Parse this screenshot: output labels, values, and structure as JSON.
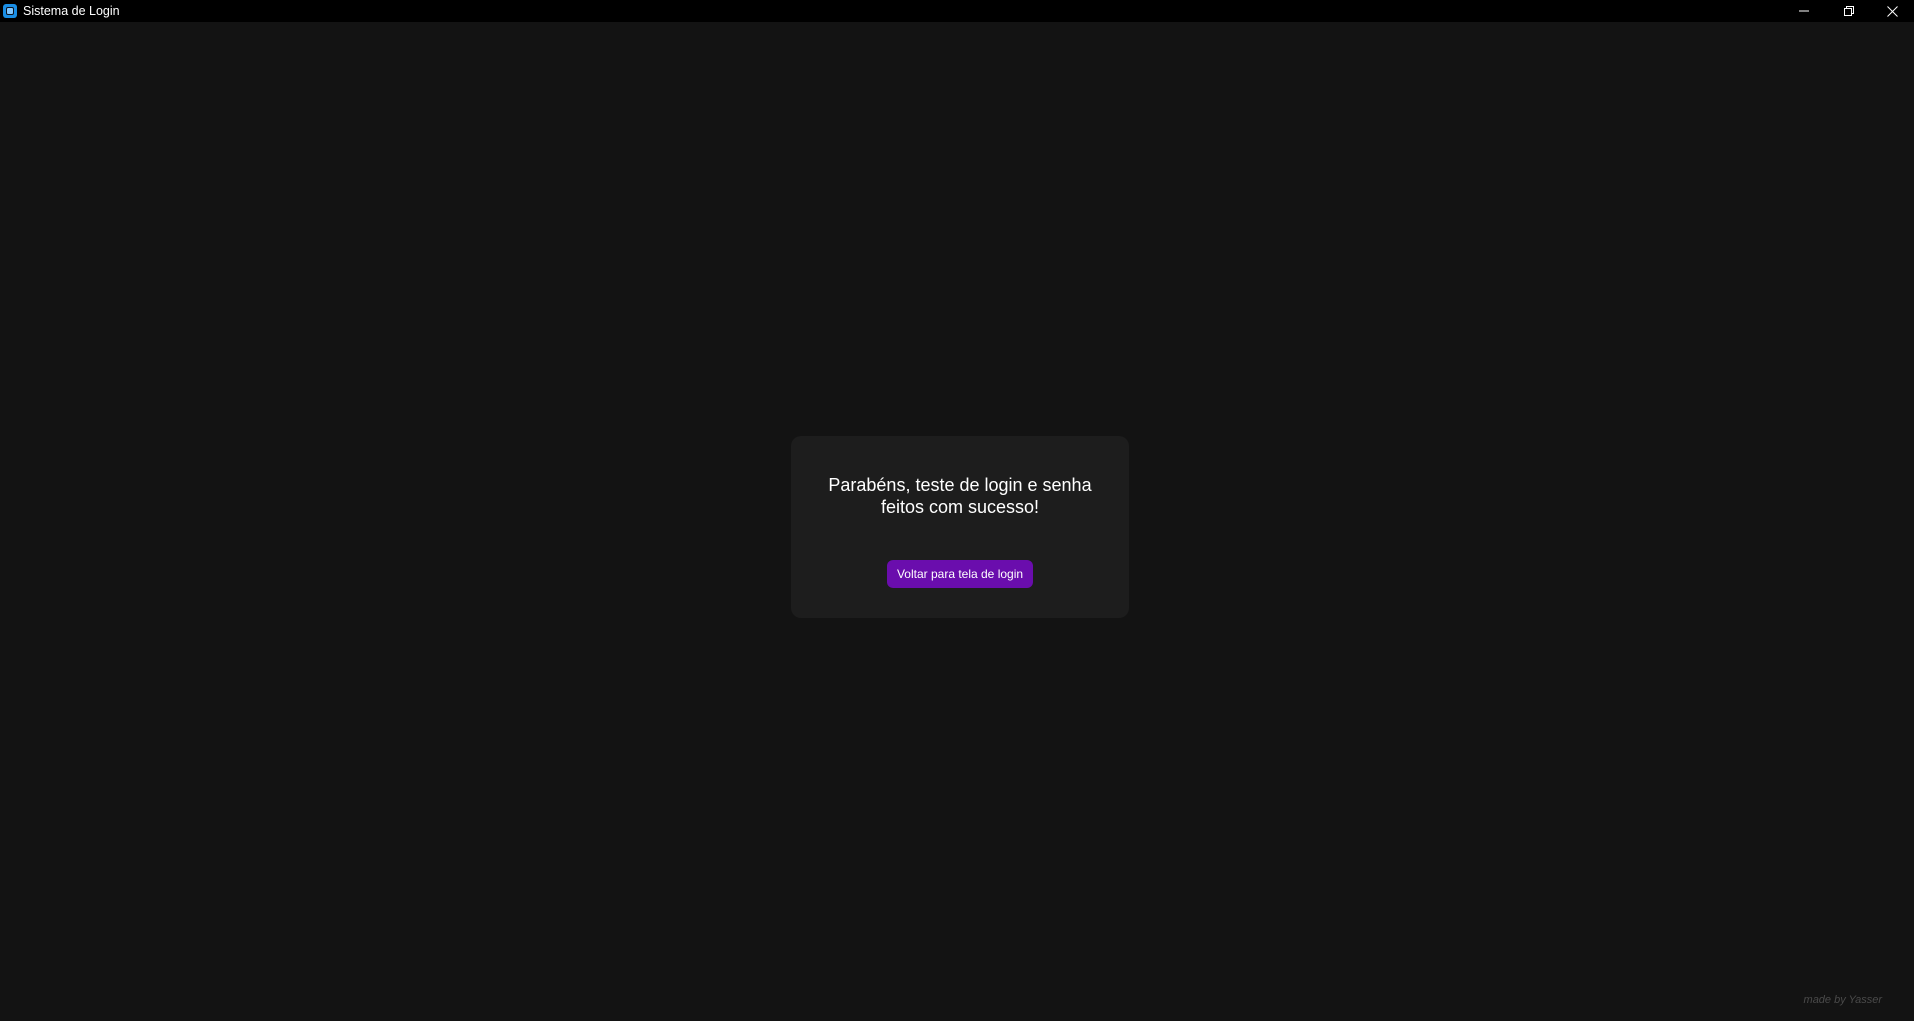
{
  "window": {
    "title": "Sistema de Login",
    "app_icon": "app-window-icon",
    "controls": {
      "minimize_icon": "minimize-icon",
      "maximize_icon": "restore-icon",
      "close_icon": "close-icon"
    }
  },
  "card": {
    "message_line1": "Parabéns, teste de login e senha",
    "message_line2": "feitos com sucesso!",
    "button_label": "Voltar para tela de login"
  },
  "footer": {
    "credit": "made by Yasser"
  },
  "colors": {
    "background": "#131313",
    "card": "#1d1d1d",
    "accent": "#6a0dad",
    "titlebar": "#000000"
  }
}
